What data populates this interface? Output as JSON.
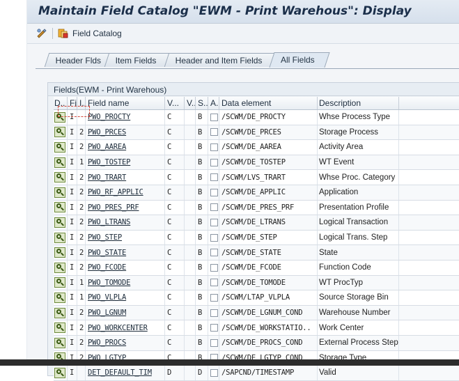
{
  "window": {
    "title": "Maintain Field Catalog \"EWM - Print Warehous\": Display"
  },
  "toolbar": {
    "toggle_icon": "display-change-icon",
    "field_catalog_label": "Field Catalog",
    "field_catalog_icon": "field-catalog-icon"
  },
  "tabs": [
    {
      "label": "Header Flds",
      "active": false
    },
    {
      "label": "Item Fields",
      "active": false
    },
    {
      "label": "Header and Item Fields",
      "active": false
    },
    {
      "label": "All Fields",
      "active": true
    }
  ],
  "panel": {
    "title": "Fields(EWM - Print Warehous)"
  },
  "grid": {
    "columns": [
      "D..",
      "Fi...",
      "I...",
      "Field name",
      "V...",
      "V..",
      "S..",
      "A..",
      "Data element",
      "Description"
    ],
    "rows": [
      {
        "fi": "I",
        "i": "",
        "field": "PWO_PROCTY",
        "v1": "C",
        "v2": "",
        "s": "B",
        "de": "/SCWM/DE_PROCTY",
        "desc": "Whse Process Type"
      },
      {
        "fi": "I",
        "i": "2",
        "field": "PWO_PRCES",
        "v1": "C",
        "v2": "",
        "s": "B",
        "de": "/SCWM/DE_PRCES",
        "desc": "Storage Process"
      },
      {
        "fi": "I",
        "i": "2",
        "field": "PWO_AAREA",
        "v1": "C",
        "v2": "",
        "s": "B",
        "de": "/SCWM/DE_AAREA",
        "desc": "Activity Area"
      },
      {
        "fi": "I",
        "i": "1",
        "field": "PWO_TOSTEP",
        "v1": "C",
        "v2": "",
        "s": "B",
        "de": "/SCWM/DE_TOSTEP",
        "desc": "WT Event"
      },
      {
        "fi": "I",
        "i": "2",
        "field": "PWO_TRART",
        "v1": "C",
        "v2": "",
        "s": "B",
        "de": "/SCWM/LVS_TRART",
        "desc": "Whse Proc. Category"
      },
      {
        "fi": "I",
        "i": "2",
        "field": "PWO_RF_APPLIC",
        "v1": "C",
        "v2": "",
        "s": "B",
        "de": "/SCWM/DE_APPLIC",
        "desc": "Application"
      },
      {
        "fi": "I",
        "i": "2",
        "field": "PWO_PRES_PRF",
        "v1": "C",
        "v2": "",
        "s": "B",
        "de": "/SCWM/DE_PRES_PRF",
        "desc": "Presentation Profile"
      },
      {
        "fi": "I",
        "i": "2",
        "field": "PWO_LTRANS",
        "v1": "C",
        "v2": "",
        "s": "B",
        "de": "/SCWM/DE_LTRANS",
        "desc": "Logical Transaction"
      },
      {
        "fi": "I",
        "i": "2",
        "field": "PWO_STEP",
        "v1": "C",
        "v2": "",
        "s": "B",
        "de": "/SCWM/DE_STEP",
        "desc": "Logical Trans. Step"
      },
      {
        "fi": "I",
        "i": "2",
        "field": "PWO_STATE",
        "v1": "C",
        "v2": "",
        "s": "B",
        "de": "/SCWM/DE_STATE",
        "desc": "State"
      },
      {
        "fi": "I",
        "i": "2",
        "field": "PWO_FCODE",
        "v1": "C",
        "v2": "",
        "s": "B",
        "de": "/SCWM/DE_FCODE",
        "desc": "Function Code"
      },
      {
        "fi": "I",
        "i": "1",
        "field": "PWO_TOMODE",
        "v1": "C",
        "v2": "",
        "s": "B",
        "de": "/SCWM/DE_TOMODE",
        "desc": "WT ProcTyp"
      },
      {
        "fi": "I",
        "i": "1",
        "field": "PWO_VLPLA",
        "v1": "C",
        "v2": "",
        "s": "B",
        "de": "/SCWM/LTAP_VLPLA",
        "desc": "Source Storage Bin"
      },
      {
        "fi": "I",
        "i": "2",
        "field": "PWO_LGNUM",
        "v1": "C",
        "v2": "",
        "s": "B",
        "de": "/SCWM/DE_LGNUM_COND",
        "desc": "Warehouse Number"
      },
      {
        "fi": "I",
        "i": "2",
        "field": "PWO_WORKCENTER",
        "v1": "C",
        "v2": "",
        "s": "B",
        "de": "/SCWM/DE_WORKSTATIO..",
        "desc": "Work Center"
      },
      {
        "fi": "I",
        "i": "2",
        "field": "PWO_PROCS",
        "v1": "C",
        "v2": "",
        "s": "B",
        "de": "/SCWM/DE_PROCS_COND",
        "desc": "External Process Step"
      },
      {
        "fi": "I",
        "i": "2",
        "field": "PWO_LGTYP",
        "v1": "C",
        "v2": "",
        "s": "B",
        "de": "/SCWM/DE_LGTYP_COND",
        "desc": "Storage Type"
      },
      {
        "fi": "I",
        "i": "",
        "field": "DET_DEFAULT_TIM",
        "v1": "D",
        "v2": "",
        "s": "D",
        "de": "/SAPCND/TIMESTAMP",
        "desc": "Valid"
      }
    ]
  }
}
